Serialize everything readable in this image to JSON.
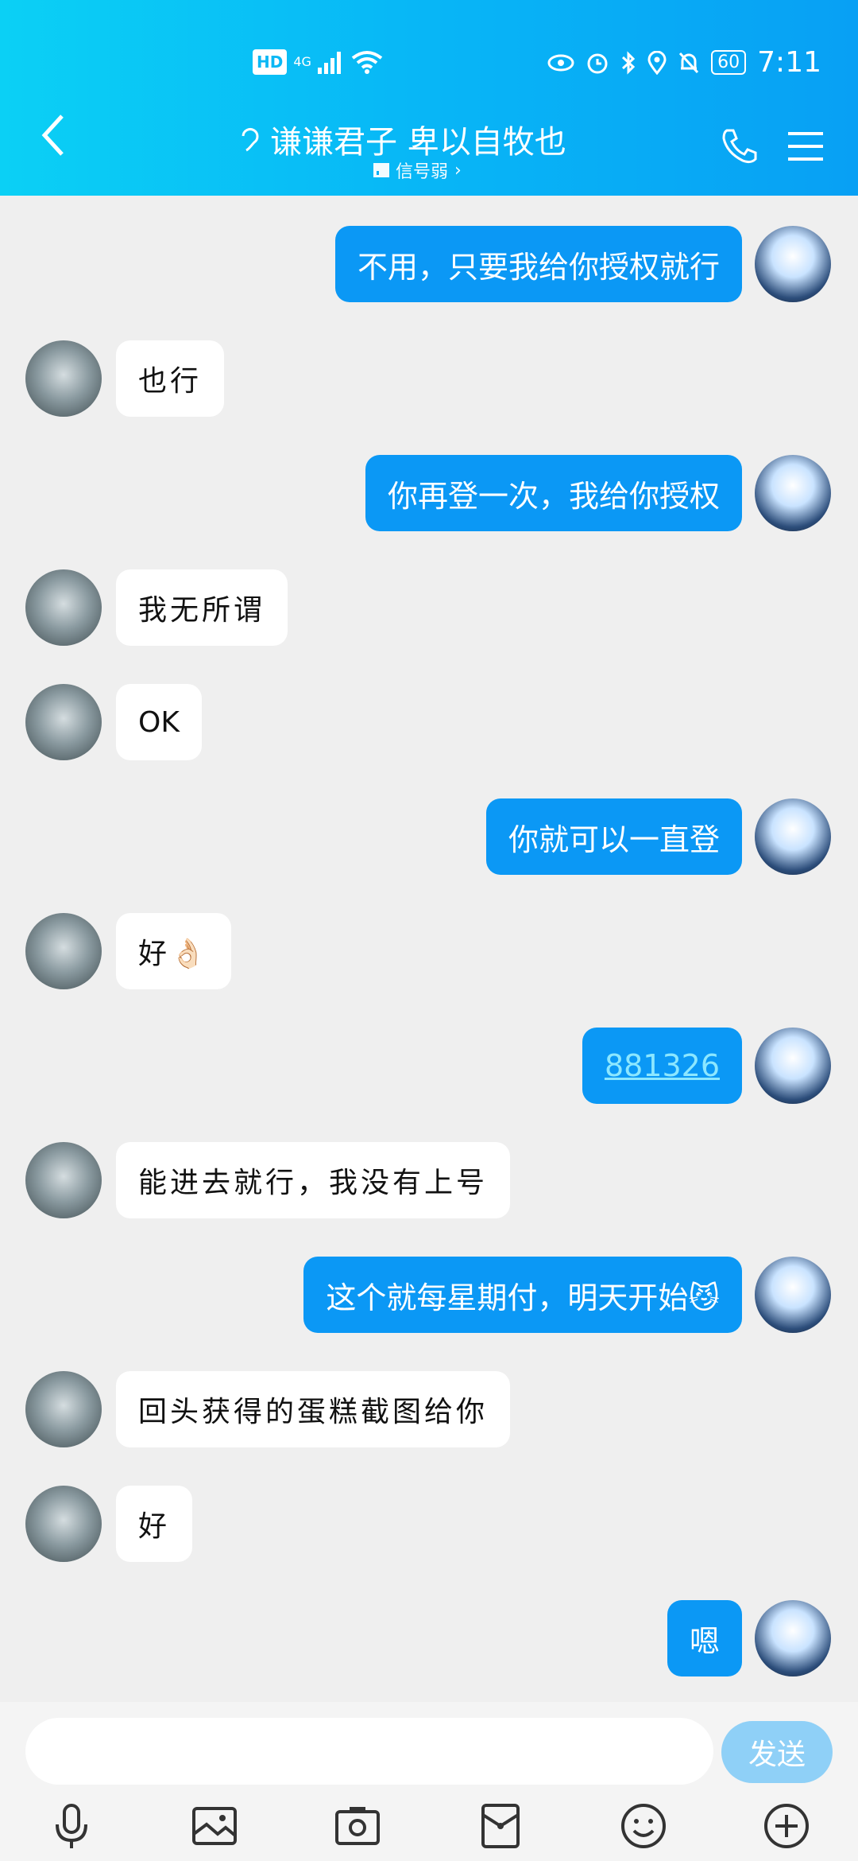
{
  "status_bar": {
    "hd": "HD",
    "network": "4G",
    "battery": "60",
    "time": "7:11"
  },
  "header": {
    "title": "谦谦君子 卑以自牧也",
    "signal_text": "信号弱"
  },
  "messages": [
    {
      "dir": "out",
      "text": "不用，只要我给你授权就行"
    },
    {
      "dir": "in",
      "text": "也行"
    },
    {
      "dir": "out",
      "text": "你再登一次，我给你授权"
    },
    {
      "dir": "in",
      "text": "我无所谓"
    },
    {
      "dir": "in",
      "text": "OK"
    },
    {
      "dir": "out",
      "text": "你就可以一直登"
    },
    {
      "dir": "in",
      "text": "好👌🏻"
    },
    {
      "dir": "out",
      "text": "881326"
    },
    {
      "dir": "in",
      "text": "能进去就行，我没有上号"
    },
    {
      "dir": "out",
      "text": "这个就每星期付，明天开始😼"
    },
    {
      "dir": "in",
      "text": "回头获得的蛋糕截图给你"
    },
    {
      "dir": "in",
      "text": "好"
    },
    {
      "dir": "out",
      "text": "嗯"
    }
  ],
  "input": {
    "value": "",
    "send_label": "发送"
  },
  "colors": {
    "header": "#0bb8f5",
    "out_bubble": "#0b98f5",
    "in_bubble": "#ffffff",
    "background": "#efefef"
  }
}
